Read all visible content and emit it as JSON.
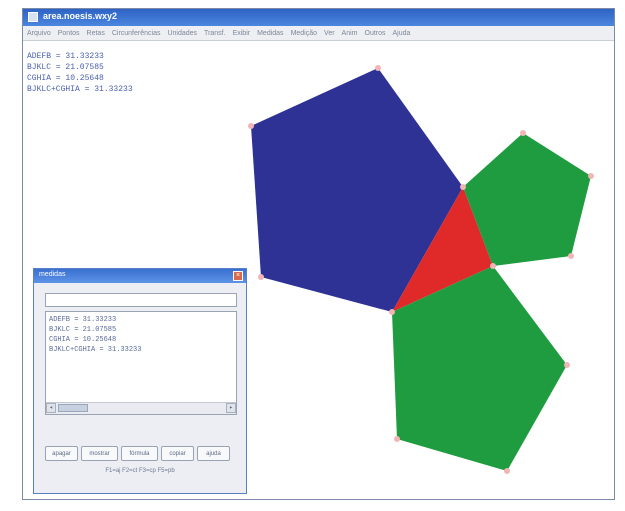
{
  "window": {
    "title": "area.noesis.wxy2",
    "menu": [
      "Arquivo",
      "Pontos",
      "Retas",
      "Circunferências",
      "Unidades",
      "Transf.",
      "Exibir",
      "Medidas",
      "Medição",
      "Ver",
      "Anim",
      "Outros",
      "Ajuda"
    ]
  },
  "measures": [
    "ADEFB = 31.33233",
    "BJKLC = 21.07585",
    "CGHIA = 10.25648",
    "BJKLC+CGHIA = 31.33233"
  ],
  "shapes": {
    "large_pentagon_color": "#2d3294",
    "triangle_color": "#e02a2a",
    "small_pentagon_color": "#1e9c3f",
    "vertex_color": "#f2b5b5"
  },
  "dialog": {
    "title": "medidas",
    "close_label": "×",
    "input_value": "",
    "output_lines": [
      "ADEFB = 31.33233",
      "BJKLC = 21.07585",
      "CGHIA = 10.25648",
      "BJKLC+CGHIA = 31.33233"
    ],
    "scroll_left": "◂",
    "scroll_right": "▸",
    "buttons": [
      "apagar",
      "mostrar",
      "fórmula",
      "copiar",
      "ajuda"
    ],
    "hint": "F1=aj  F2=ct  F3=cp  F5=pb"
  }
}
